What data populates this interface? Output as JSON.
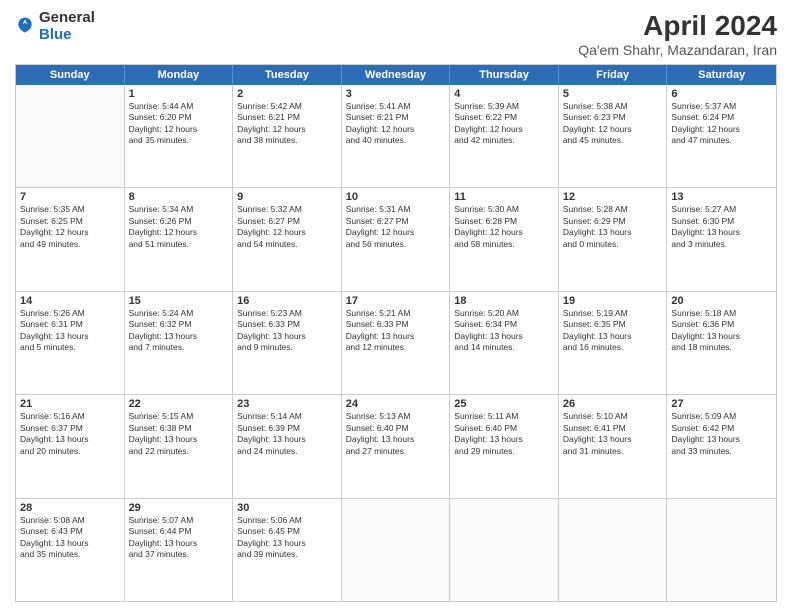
{
  "header": {
    "logo_general": "General",
    "logo_blue": "Blue",
    "month_title": "April 2024",
    "subtitle": "Qa'em Shahr, Mazandaran, Iran"
  },
  "weekdays": [
    "Sunday",
    "Monday",
    "Tuesday",
    "Wednesday",
    "Thursday",
    "Friday",
    "Saturday"
  ],
  "weeks": [
    [
      {
        "day": "",
        "info": ""
      },
      {
        "day": "1",
        "info": "Sunrise: 5:44 AM\nSunset: 6:20 PM\nDaylight: 12 hours\nand 35 minutes."
      },
      {
        "day": "2",
        "info": "Sunrise: 5:42 AM\nSunset: 6:21 PM\nDaylight: 12 hours\nand 38 minutes."
      },
      {
        "day": "3",
        "info": "Sunrise: 5:41 AM\nSunset: 6:21 PM\nDaylight: 12 hours\nand 40 minutes."
      },
      {
        "day": "4",
        "info": "Sunrise: 5:39 AM\nSunset: 6:22 PM\nDaylight: 12 hours\nand 42 minutes."
      },
      {
        "day": "5",
        "info": "Sunrise: 5:38 AM\nSunset: 6:23 PM\nDaylight: 12 hours\nand 45 minutes."
      },
      {
        "day": "6",
        "info": "Sunrise: 5:37 AM\nSunset: 6:24 PM\nDaylight: 12 hours\nand 47 minutes."
      }
    ],
    [
      {
        "day": "7",
        "info": "Sunrise: 5:35 AM\nSunset: 6:25 PM\nDaylight: 12 hours\nand 49 minutes."
      },
      {
        "day": "8",
        "info": "Sunrise: 5:34 AM\nSunset: 6:26 PM\nDaylight: 12 hours\nand 51 minutes."
      },
      {
        "day": "9",
        "info": "Sunrise: 5:32 AM\nSunset: 6:27 PM\nDaylight: 12 hours\nand 54 minutes."
      },
      {
        "day": "10",
        "info": "Sunrise: 5:31 AM\nSunset: 6:27 PM\nDaylight: 12 hours\nand 56 minutes."
      },
      {
        "day": "11",
        "info": "Sunrise: 5:30 AM\nSunset: 6:28 PM\nDaylight: 12 hours\nand 58 minutes."
      },
      {
        "day": "12",
        "info": "Sunrise: 5:28 AM\nSunset: 6:29 PM\nDaylight: 13 hours\nand 0 minutes."
      },
      {
        "day": "13",
        "info": "Sunrise: 5:27 AM\nSunset: 6:30 PM\nDaylight: 13 hours\nand 3 minutes."
      }
    ],
    [
      {
        "day": "14",
        "info": "Sunrise: 5:26 AM\nSunset: 6:31 PM\nDaylight: 13 hours\nand 5 minutes."
      },
      {
        "day": "15",
        "info": "Sunrise: 5:24 AM\nSunset: 6:32 PM\nDaylight: 13 hours\nand 7 minutes."
      },
      {
        "day": "16",
        "info": "Sunrise: 5:23 AM\nSunset: 6:33 PM\nDaylight: 13 hours\nand 9 minutes."
      },
      {
        "day": "17",
        "info": "Sunrise: 5:21 AM\nSunset: 6:33 PM\nDaylight: 13 hours\nand 12 minutes."
      },
      {
        "day": "18",
        "info": "Sunrise: 5:20 AM\nSunset: 6:34 PM\nDaylight: 13 hours\nand 14 minutes."
      },
      {
        "day": "19",
        "info": "Sunrise: 5:19 AM\nSunset: 6:35 PM\nDaylight: 13 hours\nand 16 minutes."
      },
      {
        "day": "20",
        "info": "Sunrise: 5:18 AM\nSunset: 6:36 PM\nDaylight: 13 hours\nand 18 minutes."
      }
    ],
    [
      {
        "day": "21",
        "info": "Sunrise: 5:16 AM\nSunset: 6:37 PM\nDaylight: 13 hours\nand 20 minutes."
      },
      {
        "day": "22",
        "info": "Sunrise: 5:15 AM\nSunset: 6:38 PM\nDaylight: 13 hours\nand 22 minutes."
      },
      {
        "day": "23",
        "info": "Sunrise: 5:14 AM\nSunset: 6:39 PM\nDaylight: 13 hours\nand 24 minutes."
      },
      {
        "day": "24",
        "info": "Sunrise: 5:13 AM\nSunset: 6:40 PM\nDaylight: 13 hours\nand 27 minutes."
      },
      {
        "day": "25",
        "info": "Sunrise: 5:11 AM\nSunset: 6:40 PM\nDaylight: 13 hours\nand 29 minutes."
      },
      {
        "day": "26",
        "info": "Sunrise: 5:10 AM\nSunset: 6:41 PM\nDaylight: 13 hours\nand 31 minutes."
      },
      {
        "day": "27",
        "info": "Sunrise: 5:09 AM\nSunset: 6:42 PM\nDaylight: 13 hours\nand 33 minutes."
      }
    ],
    [
      {
        "day": "28",
        "info": "Sunrise: 5:08 AM\nSunset: 6:43 PM\nDaylight: 13 hours\nand 35 minutes."
      },
      {
        "day": "29",
        "info": "Sunrise: 5:07 AM\nSunset: 6:44 PM\nDaylight: 13 hours\nand 37 minutes."
      },
      {
        "day": "30",
        "info": "Sunrise: 5:06 AM\nSunset: 6:45 PM\nDaylight: 13 hours\nand 39 minutes."
      },
      {
        "day": "",
        "info": ""
      },
      {
        "day": "",
        "info": ""
      },
      {
        "day": "",
        "info": ""
      },
      {
        "day": "",
        "info": ""
      }
    ]
  ]
}
